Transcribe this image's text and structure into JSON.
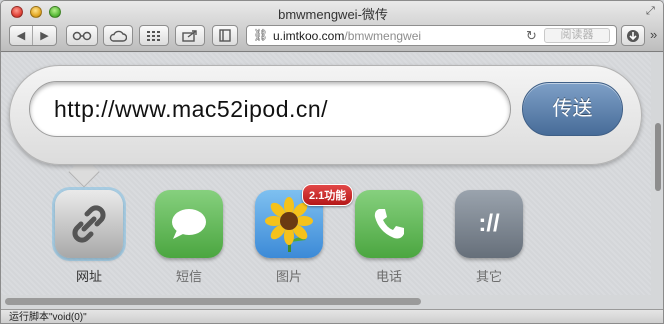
{
  "window": {
    "title": "bmwmengwei-微传"
  },
  "toolbar": {
    "url_domain": "u.imtkoo.com",
    "url_path": "/bmwmengwei",
    "reader_label": "阅读器"
  },
  "page": {
    "url_value": "http://www.mac52ipod.cn/",
    "send_label": "传送",
    "badge": "2.1功能",
    "apps": [
      {
        "label": "网址"
      },
      {
        "label": "短信"
      },
      {
        "label": "图片"
      },
      {
        "label": "电话"
      },
      {
        "label": "其它",
        "glyph": "://"
      }
    ]
  },
  "status": {
    "text": "运行脚本\"void(0)\""
  }
}
